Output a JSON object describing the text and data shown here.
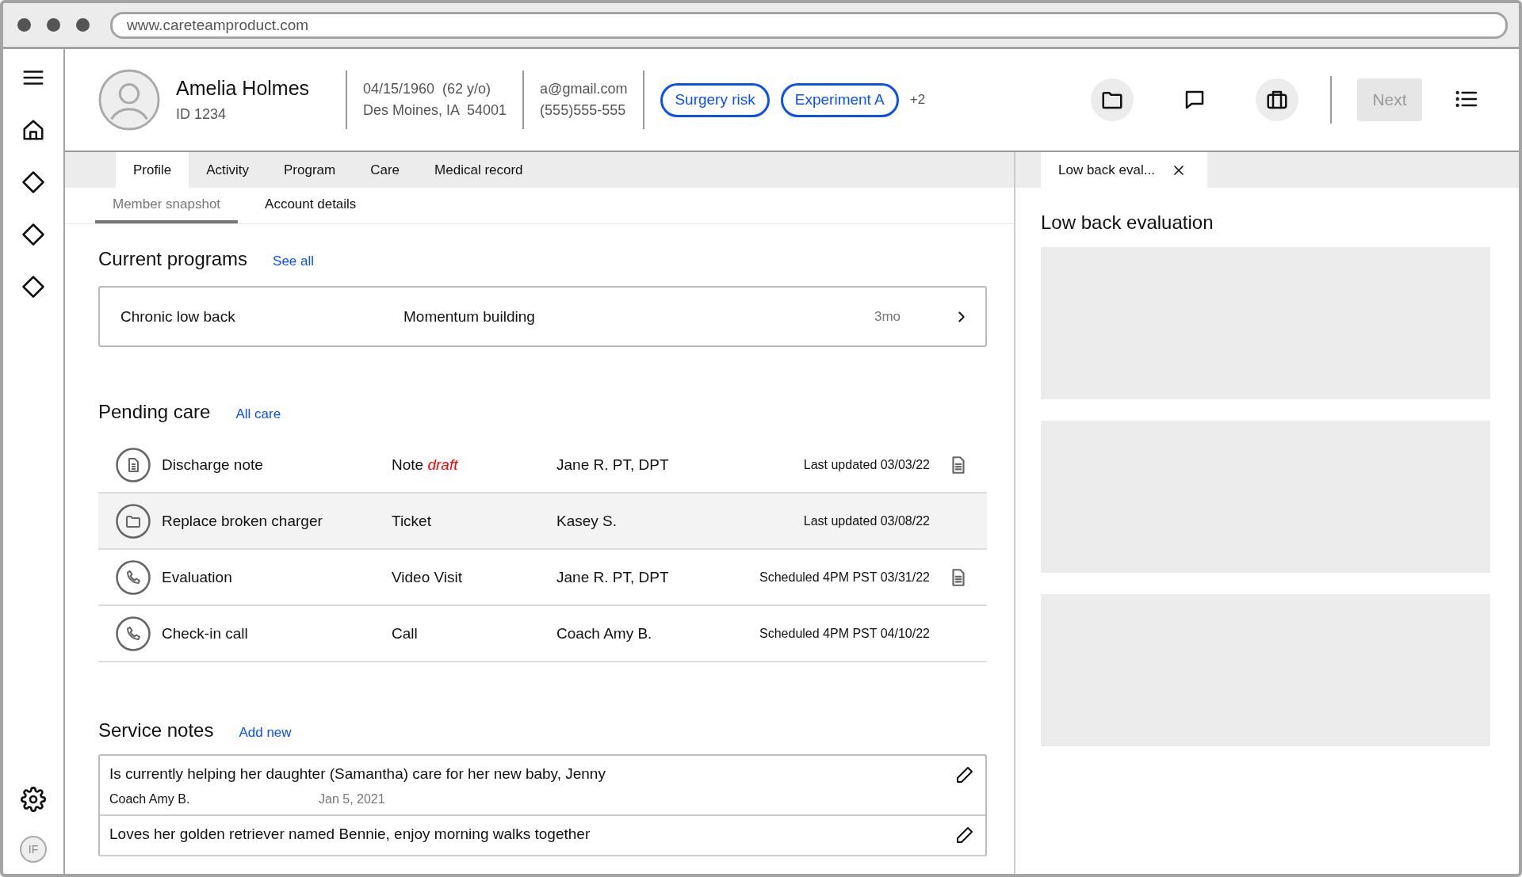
{
  "browser": {
    "url": "www.careteamproduct.com"
  },
  "sidebar": {
    "items": [
      {
        "kind": "menu"
      },
      {
        "kind": "home"
      },
      {
        "kind": "diamond"
      },
      {
        "kind": "diamond"
      },
      {
        "kind": "diamond"
      }
    ],
    "bottom": [
      {
        "kind": "settings"
      }
    ],
    "user_initials": "IF"
  },
  "header": {
    "name": "Amelia Holmes",
    "member_id": "ID 1234",
    "birth": "04/15/1960  (62 y/o)",
    "location": "Des Moines, IA  54001",
    "email": "a@gmail.com",
    "phone": "(555)555-555",
    "tags": [
      "Surgery risk",
      "Experiment A"
    ],
    "more_tags": "+2",
    "actions": [
      {
        "kind": "folder",
        "active": true
      },
      {
        "kind": "chat",
        "active": false
      },
      {
        "kind": "briefcase",
        "active": true
      }
    ],
    "next_button": {
      "label": "Next",
      "disabled": true
    }
  },
  "tabs": [
    {
      "label": "Profile",
      "selected": true
    },
    {
      "label": "Activity",
      "selected": false
    },
    {
      "label": "Program",
      "selected": false
    },
    {
      "label": "Care",
      "selected": false
    },
    {
      "label": "Medical record",
      "selected": false
    }
  ],
  "subtabs": [
    {
      "label": "Member snapshot",
      "selected": true
    },
    {
      "label": "Account details",
      "selected": false
    }
  ],
  "current_programs": {
    "title": "Current programs",
    "link": "See all",
    "items": [
      {
        "name": "Chronic low back",
        "stage": "Momentum building",
        "duration": "3mo"
      }
    ]
  },
  "pending_care": {
    "title": "Pending care",
    "link": "All care",
    "rows": [
      {
        "kind": "note",
        "title": "Discharge note",
        "type": "Note",
        "flag": "draft",
        "assignee": "Jane R. PT, DPT",
        "status": "Last updated 03/03/22",
        "attachment": true,
        "selected": false
      },
      {
        "kind": "ticket",
        "title": "Replace broken charger",
        "type": "Ticket",
        "assignee": "Kasey S.",
        "status": "Last updated 03/08/22",
        "attachment": false,
        "selected": true
      },
      {
        "kind": "call",
        "title": "Evaluation",
        "type": "Video Visit",
        "assignee": "Jane R. PT, DPT",
        "status": "Scheduled 4PM PST 03/31/22",
        "attachment": true,
        "selected": false
      },
      {
        "kind": "call",
        "title": "Check-in call",
        "type": "Call",
        "assignee": "Coach Amy B.",
        "status": "Scheduled 4PM PST 04/10/22",
        "attachment": false,
        "selected": false
      }
    ]
  },
  "service_notes": {
    "title": "Service notes",
    "link": "Add new",
    "notes": [
      {
        "text": "Is currently helping her daughter (Samantha) care for her new baby, Jenny",
        "author": "Coach Amy B.",
        "date": "Jan 5, 2021"
      },
      {
        "text": "Loves her golden retriever named Bennie, enjoy morning walks together"
      }
    ]
  },
  "side_panel": {
    "tab": "Low back eval...",
    "title": "Low back evaluation"
  }
}
